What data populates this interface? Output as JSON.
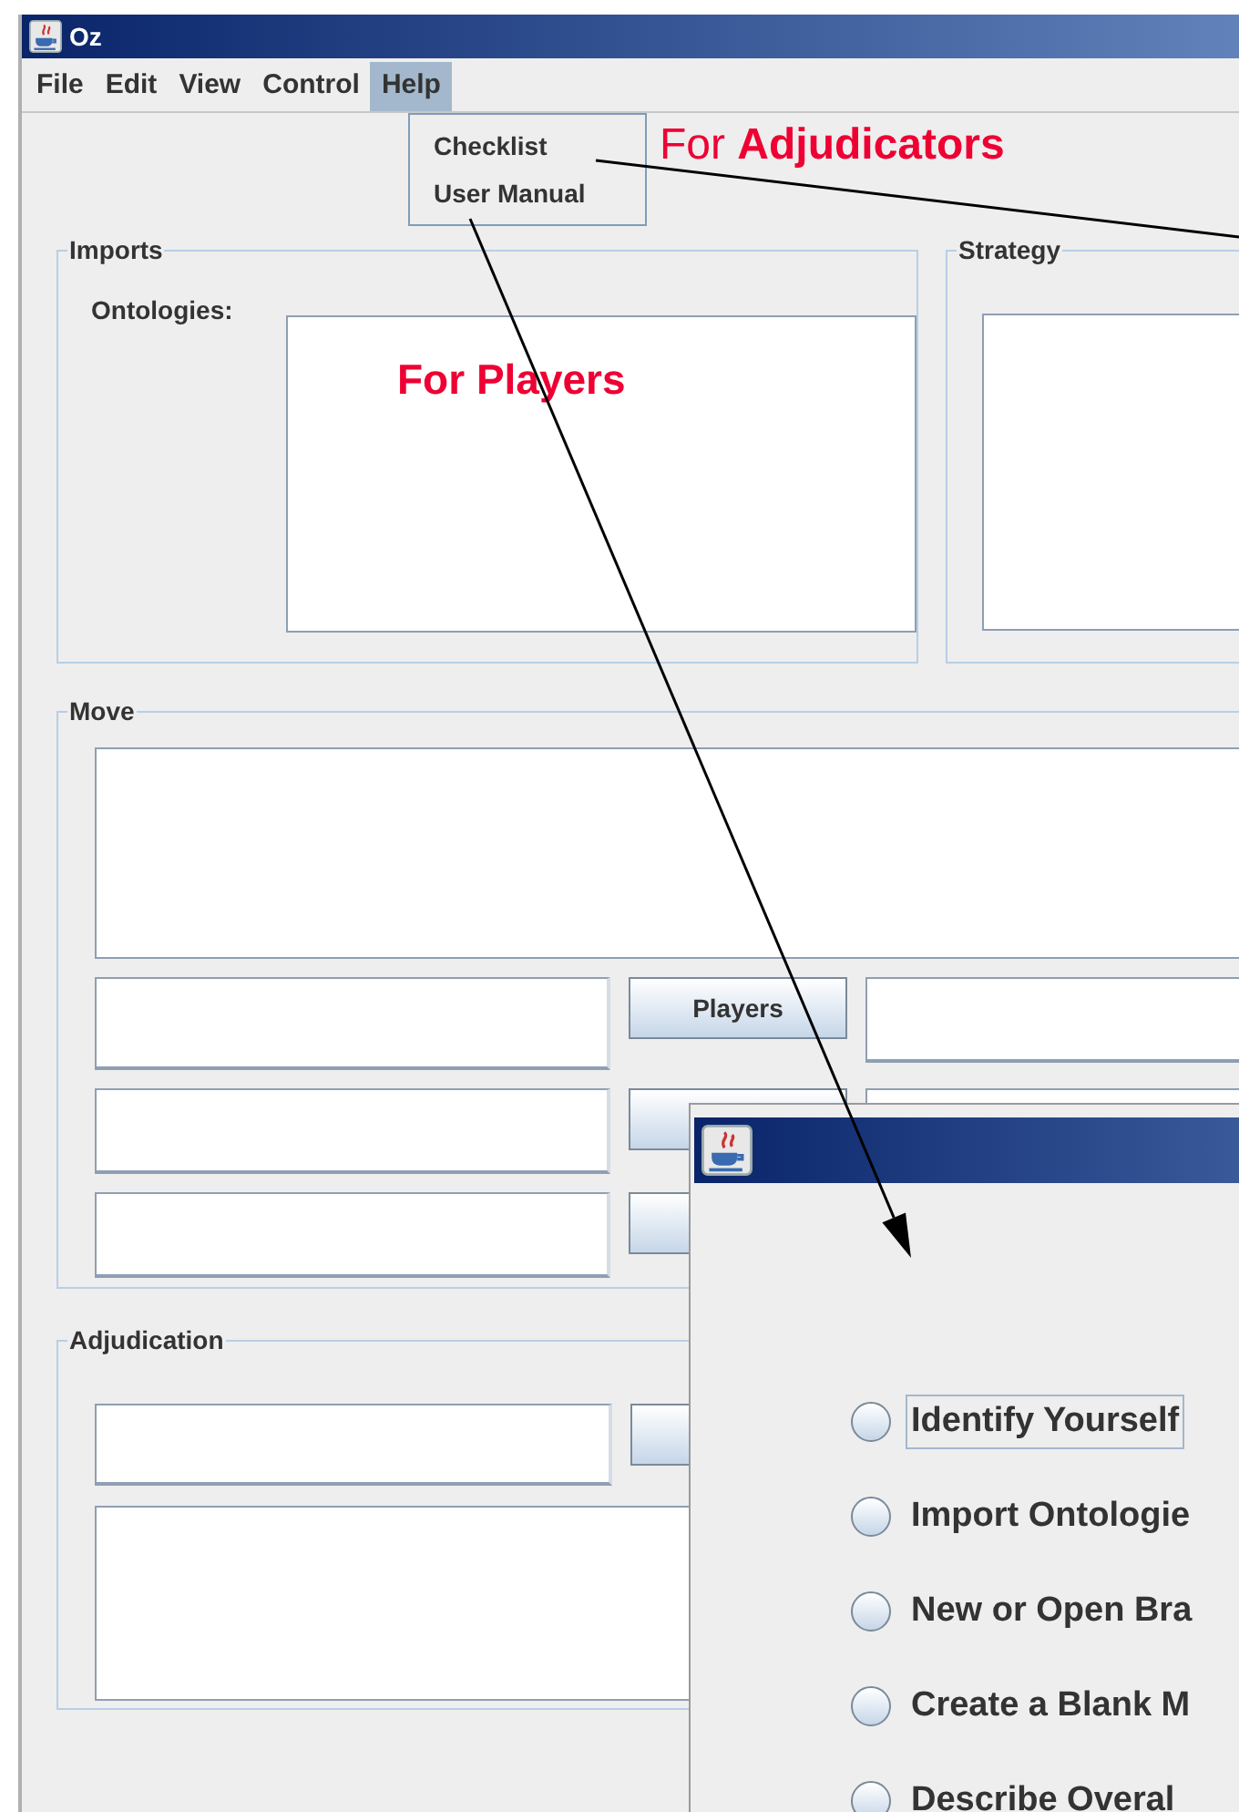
{
  "window": {
    "title": "Oz"
  },
  "menu": [
    {
      "label": "File",
      "selected": false
    },
    {
      "label": "Edit",
      "selected": false
    },
    {
      "label": "View",
      "selected": false
    },
    {
      "label": "Control",
      "selected": false
    },
    {
      "label": "Help",
      "selected": true
    }
  ],
  "help_menu": [
    {
      "label": "Checklist"
    },
    {
      "label": "User Manual"
    }
  ],
  "imports": {
    "title": "Imports",
    "label": "Ontologies:"
  },
  "strategy": {
    "title": "Strategy"
  },
  "move": {
    "title": "Move",
    "buttons": [
      "Players"
    ]
  },
  "adjudication": {
    "title": "Adjudication"
  },
  "checklist_dialog": {
    "items": [
      {
        "label": "Identify Yourself",
        "selected": false,
        "focused": true
      },
      {
        "label": "Import Ontologie",
        "selected": false,
        "focused": false
      },
      {
        "label": "New or Open Bra",
        "selected": false,
        "focused": false
      },
      {
        "label": "Create a Blank M",
        "selected": false,
        "focused": false
      },
      {
        "label": "Describe Overal",
        "selected": false,
        "focused": false
      }
    ]
  },
  "annotations": [
    {
      "text": "For **Adjudicators**",
      "bold": false
    },
    {
      "text": "For Players",
      "bold": true
    }
  ]
}
